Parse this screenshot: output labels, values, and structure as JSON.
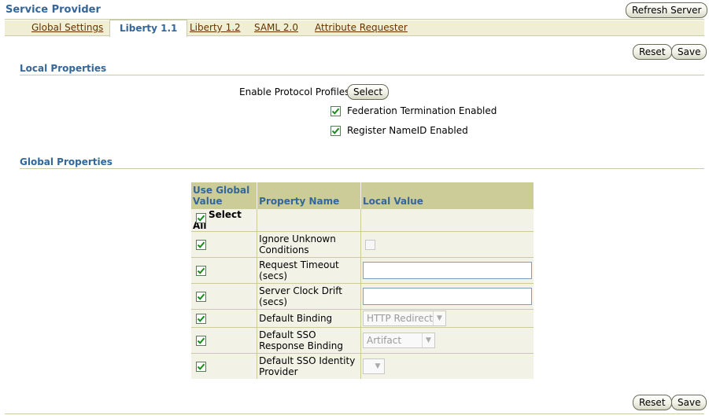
{
  "page": {
    "title": "Service Provider"
  },
  "header": {
    "refresh_button": "Refresh Server"
  },
  "tabs": [
    {
      "label": "Global Settings",
      "active": false
    },
    {
      "label": "Liberty 1.1",
      "active": true
    },
    {
      "label": "Liberty 1.2",
      "active": false
    },
    {
      "label": "SAML 2.0",
      "active": false
    },
    {
      "label": "Attribute Requester",
      "active": false
    }
  ],
  "actions": {
    "reset": "Reset",
    "save": "Save"
  },
  "local_properties": {
    "title": "Local Properties",
    "enable_profiles_label": "Enable Protocol Profiles",
    "select_button": "Select",
    "federation_termination": {
      "label": "Federation Termination Enabled",
      "checked": true
    },
    "register_nameid": {
      "label": "Register NameID Enabled",
      "checked": true
    }
  },
  "global_properties": {
    "title": "Global Properties",
    "columns": {
      "use_global": "Use Global Value",
      "property_name": "Property Name",
      "local_value": "Local Value"
    },
    "select_all": "Select All",
    "rows": [
      {
        "name": "Ignore Unknown Conditions",
        "use_global": true,
        "value_type": "checkbox"
      },
      {
        "name": "Request Timeout (secs)",
        "use_global": true,
        "value_type": "text",
        "value": ""
      },
      {
        "name": "Server Clock Drift (secs)",
        "use_global": true,
        "value_type": "text",
        "value": ""
      },
      {
        "name": "Default Binding",
        "use_global": true,
        "value_type": "select",
        "value": "HTTP Redirect"
      },
      {
        "name": "Default SSO Response Binding",
        "use_global": true,
        "value_type": "select",
        "value": "Artifact"
      },
      {
        "name": "Default SSO Identity Provider",
        "use_global": true,
        "value_type": "select",
        "value": ""
      }
    ]
  }
}
